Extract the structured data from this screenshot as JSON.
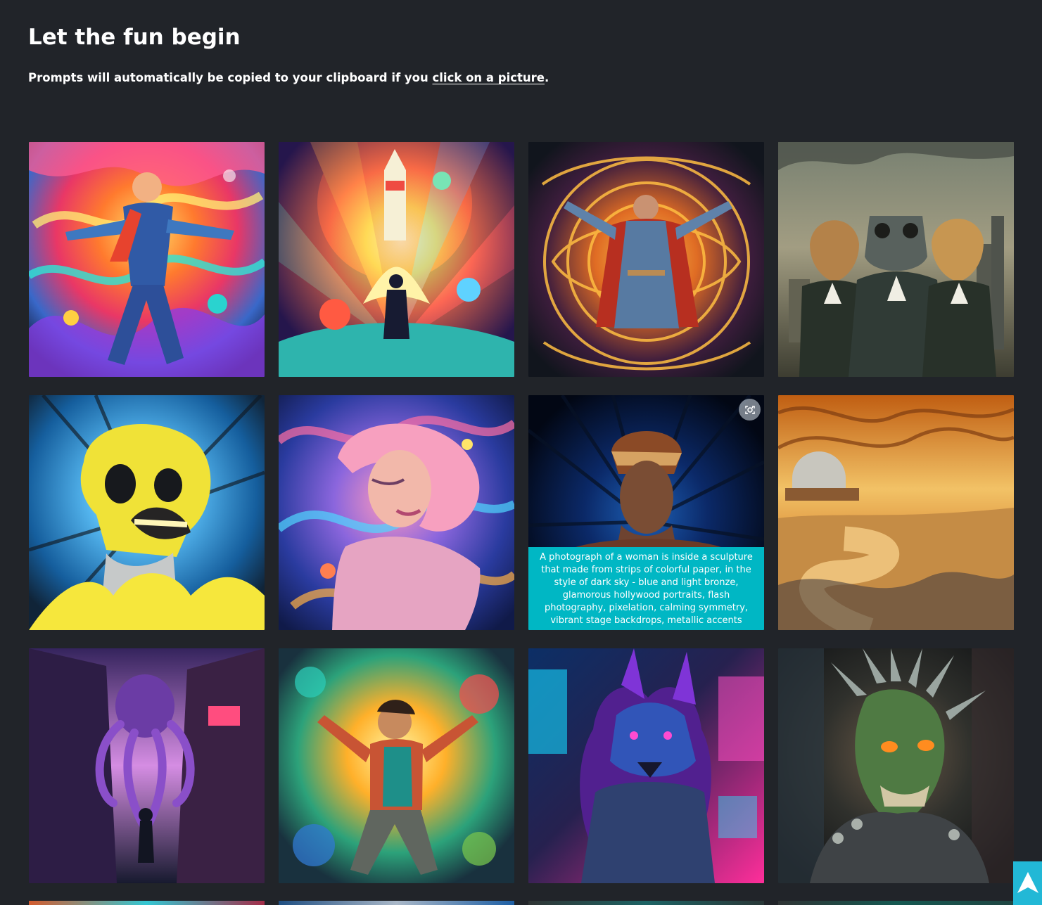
{
  "heading": "Let the fun begin",
  "intro": {
    "prefix": "Prompts will automatically be copied to your clipboard if you ",
    "link": "click on a picture",
    "suffix": "."
  },
  "tiles": [
    {
      "subject": "cosmic hero"
    },
    {
      "subject": "rocket launch"
    },
    {
      "subject": "sorcerer mandala"
    },
    {
      "subject": "three animal suits"
    },
    {
      "subject": "yellow skull"
    },
    {
      "subject": "dreaming woman"
    },
    {
      "subject": "paper sculpture woman"
    },
    {
      "subject": "orange futuristic landscape"
    },
    {
      "subject": "purple octopus city"
    },
    {
      "subject": "joyful explorer"
    },
    {
      "subject": "neon wolf warrior"
    },
    {
      "subject": "spiked green creature"
    }
  ],
  "hover_tooltip": "A photograph of a woman is inside a sculpture that made from strips of colorful paper, in the style of dark sky - blue and light bronze, glamorous hollywood portraits, flash photography, pixelation, calming symmetry, vibrant stage backdrops, metallic accents",
  "icons": {
    "visual_search": "lens-icon",
    "scroll_top": "arrow-up-icon"
  },
  "colors": {
    "background": "#212429",
    "text": "#ffffff",
    "tooltip": "#00b7c4",
    "scroll_button": "#22b8d6"
  }
}
